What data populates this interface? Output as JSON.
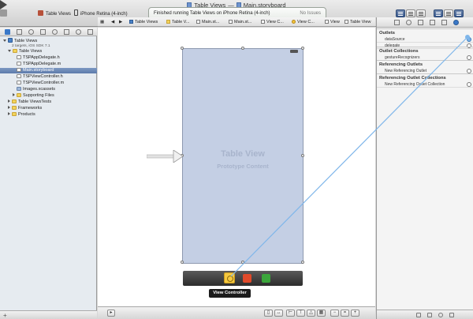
{
  "window": {
    "title_project": "Table Views",
    "title_separator": "—",
    "title_file": "Main.storyboard"
  },
  "toolbar": {
    "scheme": "Table Views",
    "destination": "iPhone Retina (4-inch)",
    "activity": "Finished running Table Views on iPhone Retina (4-inch)",
    "issues": "No Issues"
  },
  "navigator": {
    "rows": [
      {
        "label": "Table Views",
        "sub": "2 targets, iOS SDK 7.1",
        "kind": "proj"
      },
      {
        "label": "Table Views",
        "kind": "folder"
      },
      {
        "label": "TSPAppDelegate.h",
        "kind": "h"
      },
      {
        "label": "TSPAppDelegate.m",
        "kind": "m"
      },
      {
        "label": "Main.storyboard",
        "kind": "sb"
      },
      {
        "label": "TSPViewController.h",
        "kind": "h"
      },
      {
        "label": "TSPViewController.m",
        "kind": "m"
      },
      {
        "label": "Images.xcassets",
        "kind": "xa"
      },
      {
        "label": "Supporting Files",
        "kind": "folder"
      },
      {
        "label": "Table ViewsTests",
        "kind": "folder"
      },
      {
        "label": "Frameworks",
        "kind": "folder"
      },
      {
        "label": "Products",
        "kind": "folder"
      }
    ]
  },
  "jumpbar": {
    "crumbs": [
      "Table Views",
      "Table V...",
      "Main.st...",
      "Main.st...",
      "View C...",
      "View C...",
      "View",
      "Table View"
    ]
  },
  "canvas": {
    "scene_title": "Table View",
    "scene_subtitle": "Prototype Content",
    "tooltip": "View Controller"
  },
  "inspector": {
    "outlets_header": "Outlets",
    "outlets": [
      {
        "label": "dataSource",
        "connected": true
      },
      {
        "label": "delegate",
        "connected": false
      }
    ],
    "outlet_collections_header": "Outlet Collections",
    "outlet_collections": [
      {
        "label": "gestureRecognizers",
        "connected": false
      }
    ],
    "referencing_outlets_header": "Referencing Outlets",
    "referencing_outlets": [
      {
        "label": "New Referencing Outlet",
        "connected": false
      }
    ],
    "referencing_collections_header": "Referencing Outlet Collections",
    "referencing_collections": [
      {
        "label": "New Referencing Outlet Collection",
        "connected": false
      }
    ]
  },
  "colors": {
    "connection_line": "#7fb6ea",
    "selection": "#5d7bab",
    "scene_fill": "#c4cfe4"
  }
}
